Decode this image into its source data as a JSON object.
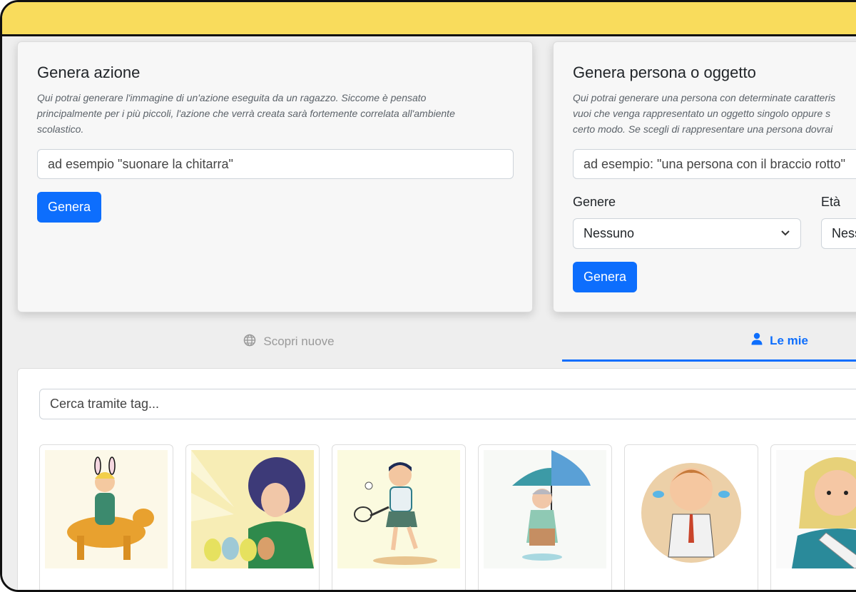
{
  "action_card": {
    "title": "Genera azione",
    "description_lines": [
      "Qui potrai generare l'immagine di un'azione eseguita da un ragazzo. Siccome è pensato",
      "principalmente per i più piccoli, l'azione che verrà creata sarà fortemente correlata all'ambiente",
      "scolastico."
    ],
    "input_value": "ad esempio \"suonare la chitarra\"",
    "button_label": "Genera"
  },
  "person_card": {
    "title": "Genera persona o oggetto",
    "description_lines": [
      "Qui potrai generare una persona con determinate caratteris",
      "vuoi che venga rappresentato un oggetto singolo oppure s",
      "certo modo. Se scegli di rappresentare una persona dovrai"
    ],
    "input_value": "ad esempio: \"una persona con il braccio rotto\"",
    "genere_label": "Genere",
    "genere_value": "Nessuno",
    "eta_label": "Età",
    "eta_value": "Ness",
    "button_label": "Genera"
  },
  "tabs": {
    "discover": "Scopri nuove",
    "mine": "Le mie"
  },
  "gallery": {
    "search_placeholder": "Cerca tramite tag..."
  },
  "colors": {
    "topbar": "#f9dc5c",
    "primary": "#0d6efd"
  }
}
